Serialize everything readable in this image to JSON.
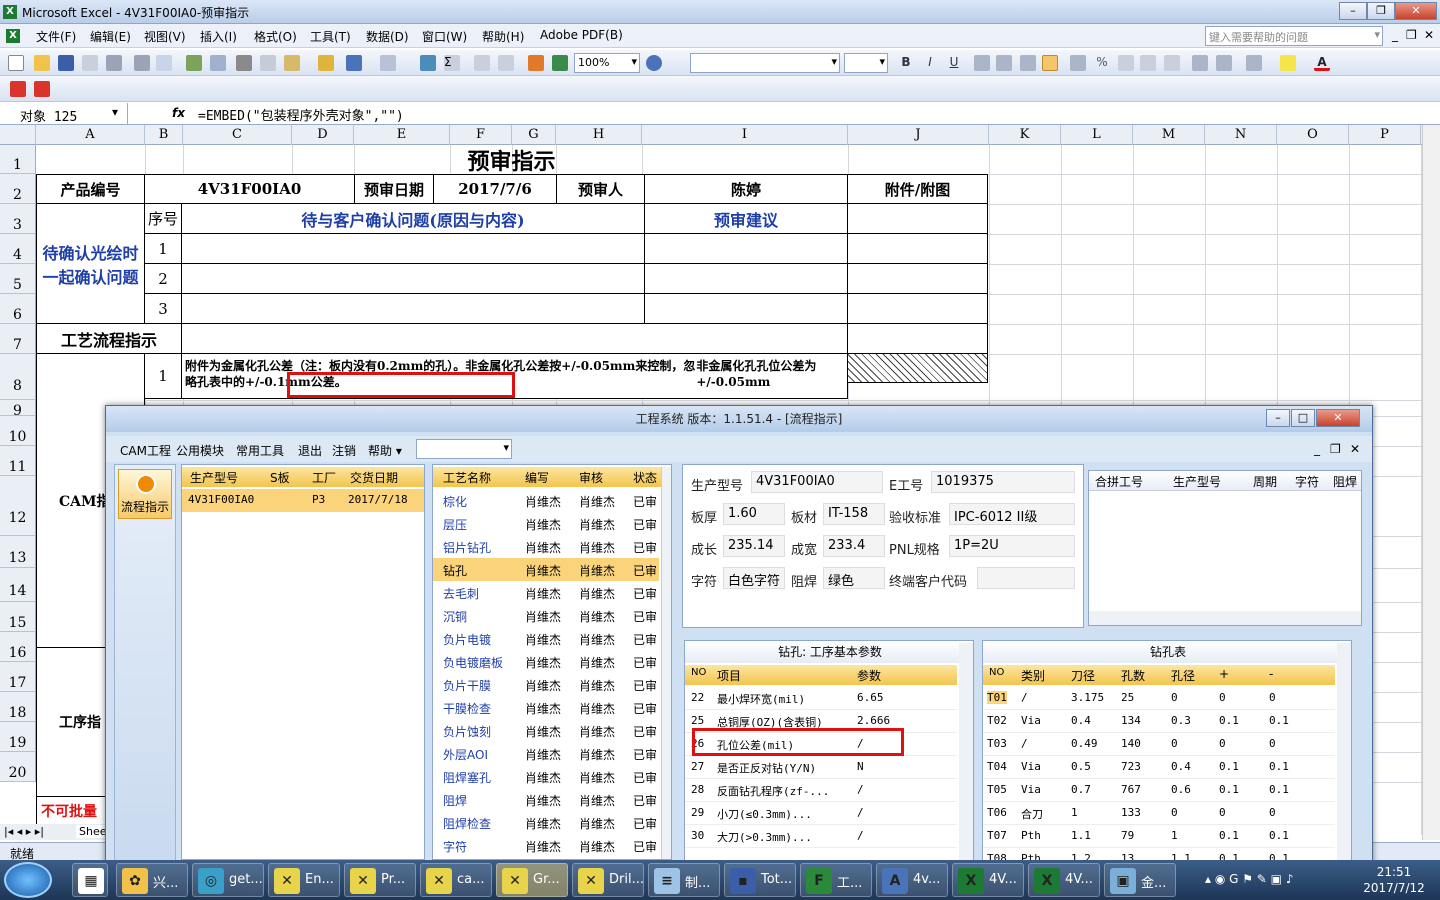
{
  "excel": {
    "title": "Microsoft Excel - 4V31F00IA0-预审指示",
    "menu": [
      "文件(F)",
      "编辑(E)",
      "视图(V)",
      "插入(I)",
      "格式(O)",
      "工具(T)",
      "数据(D)",
      "窗口(W)",
      "帮助(H)",
      "Adobe PDF(B)"
    ],
    "help_placeholder": "键入需要帮助的问题",
    "zoom": "100%",
    "namebox": "对象 125",
    "fx": "fx",
    "formula": "=EMBED(\"包装程序外壳对象\",\"\")",
    "columns": [
      "A",
      "B",
      "C",
      "D",
      "E",
      "F",
      "G",
      "H",
      "I",
      "J",
      "K",
      "L",
      "M",
      "N",
      "O",
      "P"
    ],
    "rows": [
      "1",
      "2",
      "3",
      "4",
      "5",
      "6",
      "7",
      "8",
      "9",
      "10",
      "11",
      "12",
      "13",
      "14",
      "15",
      "16",
      "17",
      "18",
      "19",
      "20"
    ],
    "sheet": {
      "title": "预审指示",
      "product_no_label": "产品编号",
      "product_no": "4V31F00IA0",
      "date_label": "预审日期",
      "date": "2017/7/6",
      "reviewer_label": "预审人",
      "reviewer": "陈婷",
      "attach_label": "附件/附图",
      "seq_label": "序号",
      "issue_label": "待与客户确认问题(原因与内容)",
      "advice_label": "预审建议",
      "confirm_label": "待确认光绘时一起确认问题",
      "seq": [
        "1",
        "2",
        "3"
      ],
      "process_label": "工艺流程指示",
      "cam_label": "CAM指",
      "proc_label": "工序指",
      "nobatch_label": "不可批量",
      "row8_seq": "1",
      "row8_text": "附件为金属化孔公差（注：板内没有0.2mm的孔）。非金属化孔公差按+/-0.05mm来控制，忽略孔表中的+/-0.1mm公差。",
      "row8_highlight": "非金属化孔孔位公差为+/-0.05mm"
    },
    "sheet_tab": "Shee",
    "status": "就绪"
  },
  "dialog": {
    "title": "工程系统  版本：1.1.51.4 - [流程指示]",
    "menu": [
      "CAM工程",
      "公用模块",
      "常用工具",
      "退出",
      "注销",
      "帮助 ▾"
    ],
    "flow_btn": "流程指示",
    "orders": {
      "headers": [
        "生产型号",
        "S板",
        "工厂",
        "交货日期"
      ],
      "rows": [
        [
          "4V31F00IA0",
          "",
          "P3",
          "2017/7/18"
        ]
      ]
    },
    "process": {
      "headers": [
        "工艺名称",
        "编写",
        "审核",
        "状态"
      ],
      "rows": [
        [
          "棕化",
          "肖维杰",
          "肖维杰",
          "已审"
        ],
        [
          "层压",
          "肖维杰",
          "肖维杰",
          "已审"
        ],
        [
          "铝片钻孔",
          "肖维杰",
          "肖维杰",
          "已审"
        ],
        [
          "钻孔",
          "肖维杰",
          "肖维杰",
          "已审"
        ],
        [
          "去毛刺",
          "肖维杰",
          "肖维杰",
          "已审"
        ],
        [
          "沉铜",
          "肖维杰",
          "肖维杰",
          "已审"
        ],
        [
          "负片电镀",
          "肖维杰",
          "肖维杰",
          "已审"
        ],
        [
          "负电镀磨板",
          "肖维杰",
          "肖维杰",
          "已审"
        ],
        [
          "负片干膜",
          "肖维杰",
          "肖维杰",
          "已审"
        ],
        [
          "干膜检查",
          "肖维杰",
          "肖维杰",
          "已审"
        ],
        [
          "负片蚀刻",
          "肖维杰",
          "肖维杰",
          "已审"
        ],
        [
          "外层AOI",
          "肖维杰",
          "肖维杰",
          "已审"
        ],
        [
          "阻焊塞孔",
          "肖维杰",
          "肖维杰",
          "已审"
        ],
        [
          "阻焊",
          "肖维杰",
          "肖维杰",
          "已审"
        ],
        [
          "阻焊检查",
          "肖维杰",
          "肖维杰",
          "已审"
        ],
        [
          "字符",
          "肖维杰",
          "肖维杰",
          "已审"
        ]
      ]
    },
    "info": {
      "model_label": "生产型号",
      "model": "4V31F00IA0",
      "eno_label": "E工号",
      "eno": "1019375",
      "thick_label": "板厚",
      "thick": "1.60",
      "mat_label": "板材",
      "mat": "IT-158",
      "std_label": "验收标准",
      "std": "IPC-6012 II级",
      "len_label": "成长",
      "len": "235.14",
      "wid_label": "成宽",
      "wid": "233.4",
      "pnl_label": "PNL规格",
      "pnl": "1P=2U",
      "char_label": "字符",
      "char": "白色字符",
      "mask_label": "阻焊",
      "mask": "绿色",
      "cust_label": "终端客户代码",
      "cust": ""
    },
    "combine": {
      "headers": [
        "合拼工号",
        "生产型号",
        "周期",
        "字符",
        "阻焊"
      ]
    },
    "params": {
      "title": "钻孔: 工序基本参数",
      "headers": [
        "NO",
        "项目",
        "参数"
      ],
      "rows": [
        [
          "22",
          "最小焊环宽(mil)",
          "6.65"
        ],
        [
          "25",
          "总铜厚(OZ)(含表铜)",
          "2.666"
        ],
        [
          "26",
          "孔位公差(mil)",
          "/"
        ],
        [
          "27",
          "是否正反对钻(Y/N)",
          "N"
        ],
        [
          "28",
          "反面钻孔程序(zf-...",
          "/"
        ],
        [
          "29",
          "小刀(≤0.3mm)...",
          "/"
        ],
        [
          "30",
          "大刀(>0.3mm)...",
          "/"
        ]
      ]
    },
    "drill": {
      "title": "钻孔表",
      "headers": [
        "NO",
        "类别",
        "刀径",
        "孔数",
        "孔径",
        "+",
        "-"
      ],
      "rows": [
        [
          "T01",
          "/",
          "3.175",
          "25",
          "0",
          "0",
          "0"
        ],
        [
          "T02",
          "Via",
          "0.4",
          "134",
          "0.3",
          "0.1",
          "0.1"
        ],
        [
          "T03",
          "/",
          "0.49",
          "140",
          "0",
          "0",
          "0"
        ],
        [
          "T04",
          "Via",
          "0.5",
          "723",
          "0.4",
          "0.1",
          "0.1"
        ],
        [
          "T05",
          "Via",
          "0.7",
          "767",
          "0.6",
          "0.1",
          "0.1"
        ],
        [
          "T06",
          "合刀",
          "1",
          "133",
          "0",
          "0",
          "0"
        ],
        [
          "T07",
          "Pth",
          "1.1",
          "79",
          "1",
          "0.1",
          "0.1"
        ],
        [
          "T08",
          "Pth",
          "1.2",
          "13",
          "1.1",
          "0.1",
          "0.1"
        ]
      ]
    }
  },
  "taskbar": {
    "buttons": [
      "兴...",
      "get...",
      "En...",
      "Pr...",
      "ca...",
      "Gr...",
      "Dril...",
      "制...",
      "Tot...",
      "工...",
      "4v...",
      "4V...",
      "4V...",
      "金..."
    ],
    "time": "21:51",
    "date": "2017/7/12"
  },
  "colors": {
    "accent": "#1f3fa8",
    "highlight": "#e01010"
  }
}
